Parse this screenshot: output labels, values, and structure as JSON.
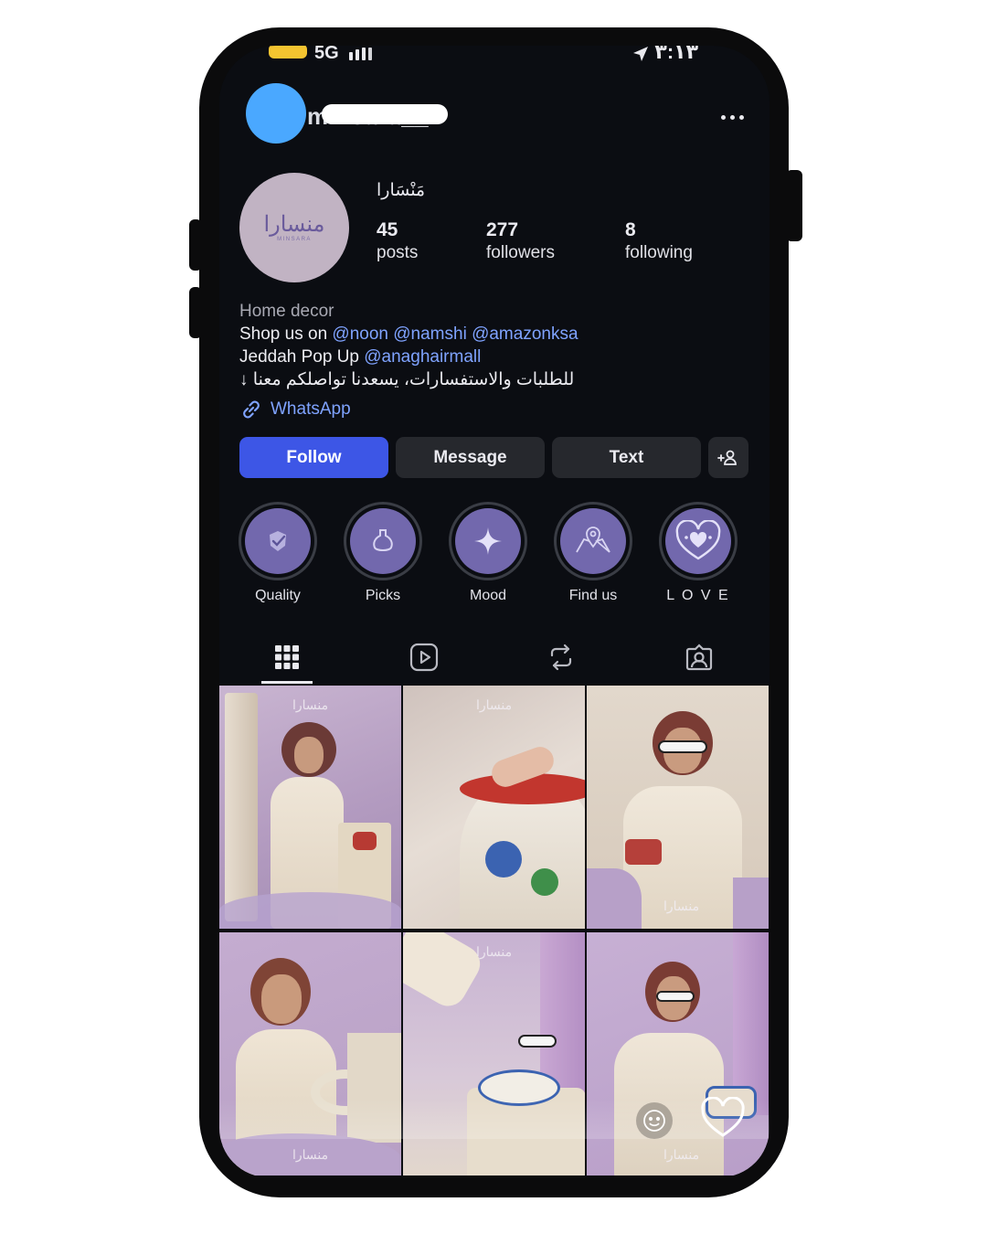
{
  "status_bar": {
    "network": "5G",
    "time": "٣:١٣"
  },
  "header": {
    "username": "minsara__"
  },
  "profile": {
    "display_name": "مَنْسَارا",
    "logo_text": "منسارا",
    "logo_subtext": "MINSARA",
    "stats": {
      "posts": {
        "value": "45",
        "label": "posts"
      },
      "followers": {
        "value": "277",
        "label": "followers"
      },
      "following": {
        "value": "8",
        "label": "following"
      }
    },
    "bio": {
      "category": "Home decor",
      "line1_prefix": "Shop us on ",
      "line1_mentions": "@noon @namshi @amazonksa",
      "line2_prefix": "Jeddah Pop Up ",
      "line2_mention": "@anaghairmall",
      "line3": "للطلبات والاستفسارات، يسعدنا تواصلكم معنا ↓"
    },
    "link": "WhatsApp"
  },
  "actions": {
    "follow": "Follow",
    "message": "Message",
    "text": "Text"
  },
  "highlights": [
    {
      "label": "Quality",
      "icon": "check-badge-icon"
    },
    {
      "label": "Picks",
      "icon": "vase-icon"
    },
    {
      "label": "Mood",
      "icon": "sparkle-icon"
    },
    {
      "label": "Find us",
      "icon": "map-pin-icon"
    },
    {
      "label": "L O V E",
      "icon": "heart-icon"
    }
  ],
  "tabs": [
    "grid-icon",
    "reels-icon",
    "reposts-icon",
    "tagged-icon"
  ],
  "grid_watermark": "منسارا",
  "colors": {
    "accent": "#3d56e6",
    "link": "#7fa3ff",
    "highlight": "#7268ad"
  }
}
